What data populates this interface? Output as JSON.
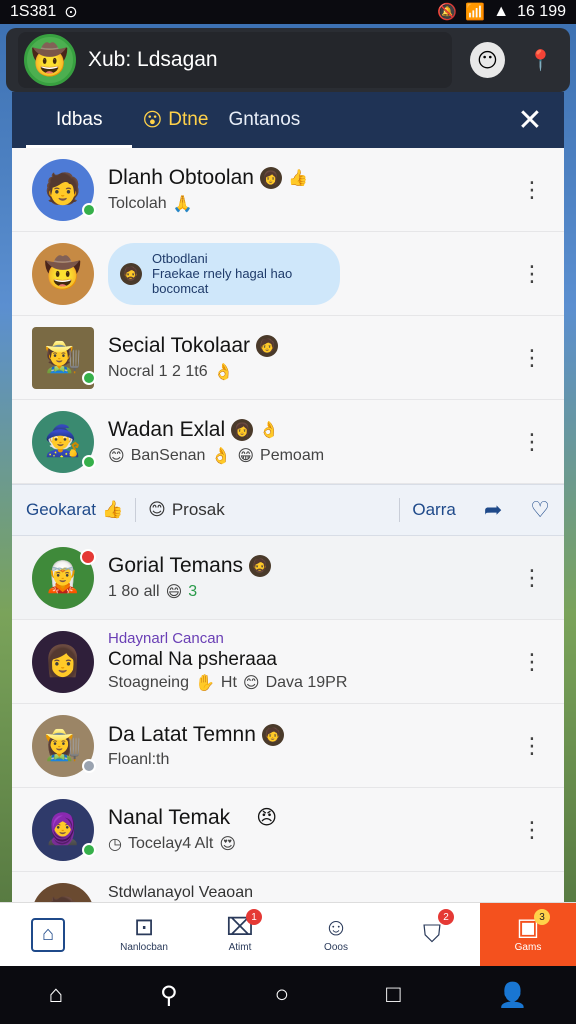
{
  "status_bar": {
    "time": "1S381",
    "right_text": "16 199"
  },
  "header": {
    "title": "Xub: Ldsagan"
  },
  "tabs": [
    {
      "label": "Idbas",
      "active": true
    },
    {
      "label": "Dtne",
      "emoji": "😮"
    },
    {
      "label": "Gntanos"
    }
  ],
  "rows": [
    {
      "name": "Dlanh Obtoolan",
      "sub": "Tolcolah",
      "name_emoji": "👍",
      "sub_emoji": "🙏"
    },
    {
      "bubble_line1": "Otbodlani",
      "bubble_line2": "Fraekae rnely hagal hao",
      "bubble_line3": "bocomcat"
    },
    {
      "name": "Secial Tokolaar",
      "sub": "Nocral 1 2 1t6",
      "sub_emoji": "👌"
    },
    {
      "name": "Wadan Exlal",
      "sub": "BanSenan",
      "sub_emoji": "👌",
      "sub2": "Pemoam"
    },
    {
      "name": "Gorial Temans",
      "sub": "1 8o all",
      "sub_emoji": "😄",
      "sub_num": "3"
    },
    {
      "above": "Hdaynarl Cancan",
      "name": "Comal Na psheraaa",
      "sub": "Stoagneing",
      "sub_emoji": "✋",
      "sub2": "Ht",
      "sub3": "Dava 19PR"
    },
    {
      "name": "Da Latat Temnn",
      "sub": "Floanl:th"
    },
    {
      "name": "Nanal Temak",
      "sub": "Tocelay4 Alt",
      "name_emoji": "😠",
      "sub_emoji": "😍"
    },
    {
      "name": "Stdwlanayol Veaoan"
    }
  ],
  "action_bar": {
    "left": "Geokarat",
    "left_emoji": "👍",
    "middle": "Prosak",
    "middle_emoji": "😊",
    "right": "Oarra"
  },
  "bottom_nav": [
    {
      "label": ""
    },
    {
      "label": "Nanlocban"
    },
    {
      "label": "Atimt",
      "badge": "1"
    },
    {
      "label": "Ooos"
    },
    {
      "label": "",
      "badge": "2"
    },
    {
      "label": "Gams",
      "badge": "3"
    }
  ]
}
